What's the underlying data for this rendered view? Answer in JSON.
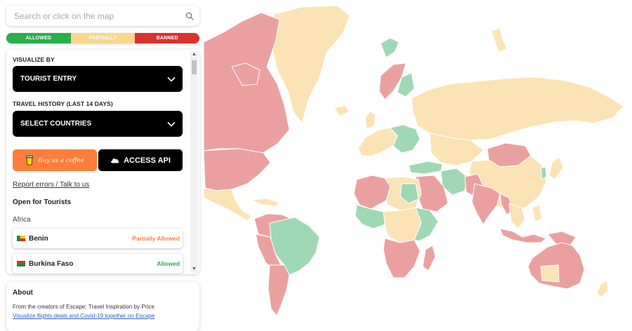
{
  "search": {
    "placeholder": "Search or click on the map"
  },
  "legend": [
    {
      "label": "ALLOWED",
      "color": "#28b04a"
    },
    {
      "label": "PARTIALLY",
      "color": "#fbd68d"
    },
    {
      "label": "BANNED",
      "color": "#d8322b"
    }
  ],
  "panel": {
    "visualize_label": "VISUALIZE BY",
    "visualize_value": "TOURIST ENTRY",
    "history_label": "TRAVEL HISTORY (LAST 14 DAYS)",
    "history_value": "SELECT COUNTRIES",
    "coffee_label": "Buy us a coffee",
    "api_label": "ACCESS API",
    "report_link": "Report errors / Talk to us",
    "open_heading": "Open for Tourists",
    "region": "Africa",
    "countries": [
      {
        "name": "Benin",
        "status": "Partially Allowed",
        "status_color": "#fd7d3b"
      },
      {
        "name": "Burkina Faso",
        "status": "Allowed",
        "status_color": "#2aa84a"
      }
    ]
  },
  "about": {
    "title": "About",
    "description": "From the creators of Escape: Travel Inspiration by Price",
    "link": "Visualize flights deals and Covid-19 together on Escape"
  },
  "map": {
    "colors": {
      "allowed": "#9fd8b4",
      "partially": "#fbe3b5",
      "banned": "#eba0a0"
    }
  }
}
